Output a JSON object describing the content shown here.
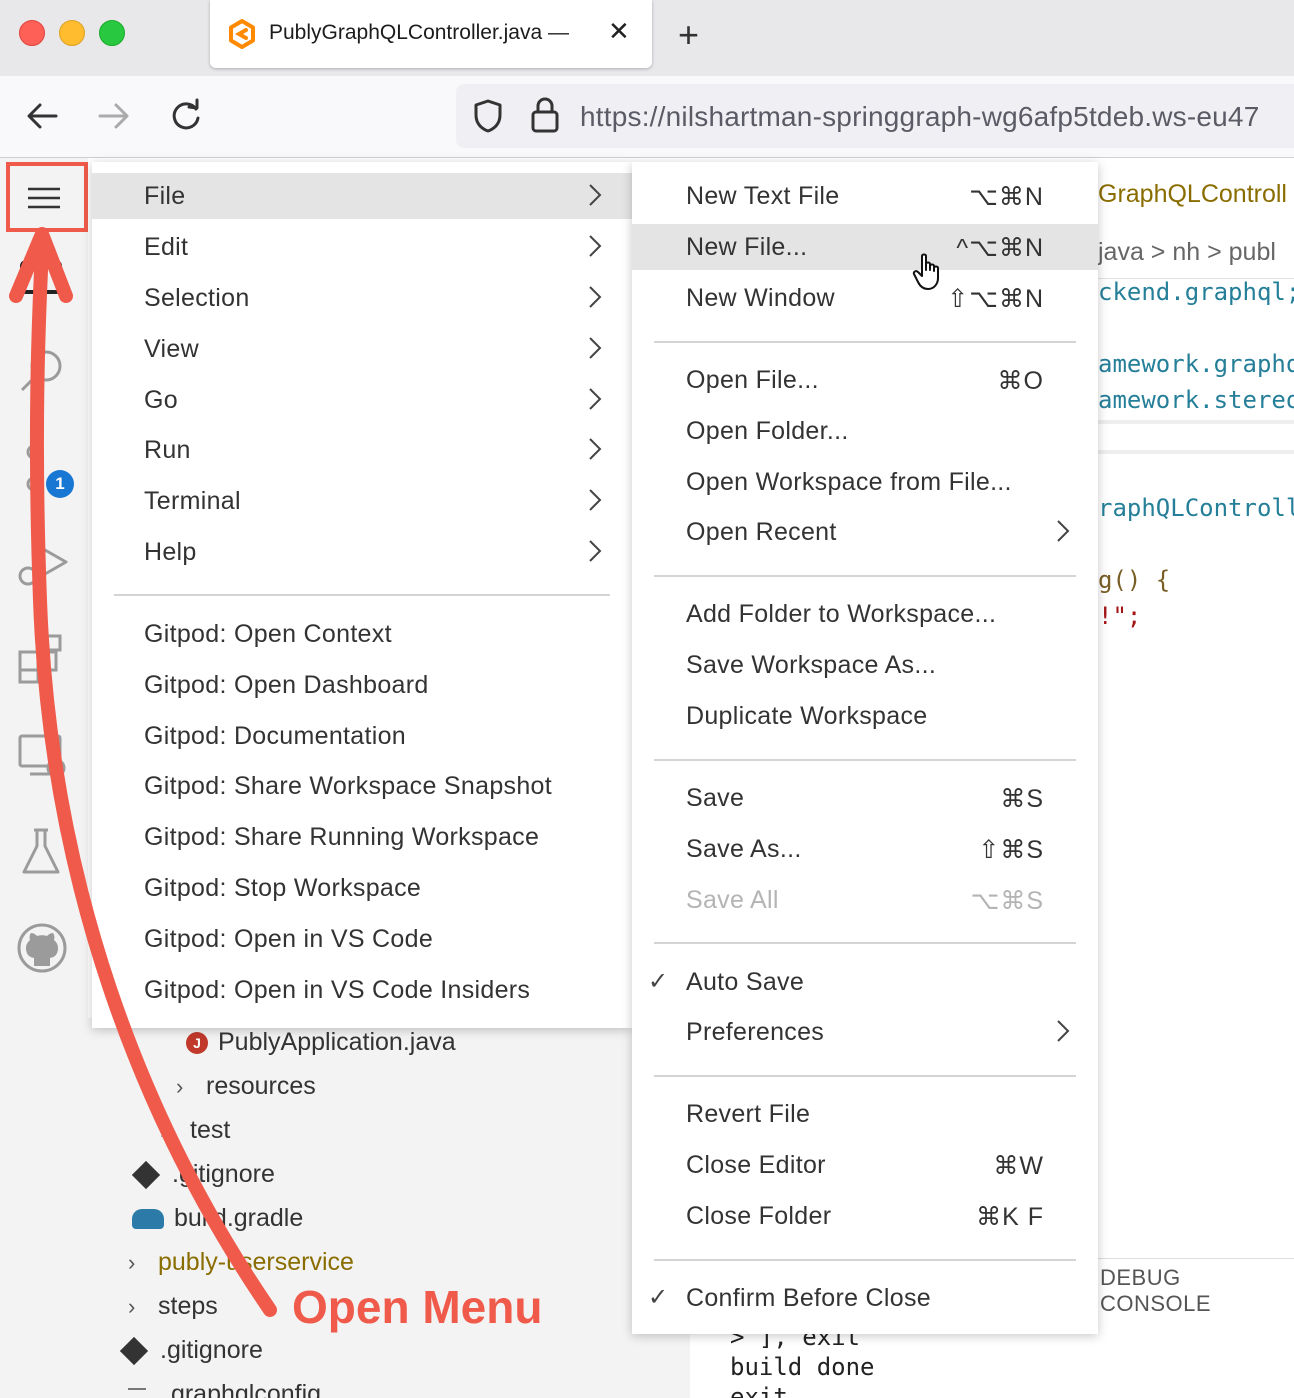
{
  "browser": {
    "tab_title": "PublyGraphQLController.java — ",
    "url": "https://nilshartman-springgraph-wg6afp5tdeb.ws-eu47"
  },
  "activity_bar": {
    "scm_badge": "1"
  },
  "explorer": {
    "rows": [
      {
        "label": "PublyApplication.java",
        "icon": "java-file-icon"
      },
      {
        "label": "resources",
        "icon": "chevron-right-icon"
      },
      {
        "label": "test",
        "icon": "chevron-right-icon"
      },
      {
        "label": ".gitignore",
        "icon": "git-file-icon"
      },
      {
        "label": "build.gradle",
        "icon": "gradle-icon"
      },
      {
        "label": "publy-userservice",
        "icon": "chevron-right-icon"
      },
      {
        "label": "steps",
        "icon": "chevron-right-icon"
      },
      {
        "label": ".gitignore",
        "icon": "git-file-icon"
      },
      {
        "label": ".graphqlconfig",
        "icon": "file-icon"
      }
    ]
  },
  "editor": {
    "lines": [
      "GraphQLControll",
      "java > nh > publ",
      "ckend.graphql;",
      "amework.graphq",
      "amework.stereo",
      "raphQLControll",
      "g() {",
      "!\";"
    ]
  },
  "panel": {
    "debug_console": "DEBUG CONSOLE",
    "terminal": [
      "> ], exit",
      "build done",
      "exit"
    ]
  },
  "main_menu": {
    "items": [
      {
        "label": "File",
        "submenu": true,
        "active": true
      },
      {
        "label": "Edit",
        "submenu": true
      },
      {
        "label": "Selection",
        "submenu": true
      },
      {
        "label": "View",
        "submenu": true
      },
      {
        "label": "Go",
        "submenu": true
      },
      {
        "label": "Run",
        "submenu": true
      },
      {
        "label": "Terminal",
        "submenu": true
      },
      {
        "label": "Help",
        "submenu": true
      },
      {
        "label": "Gitpod: Open Context"
      },
      {
        "label": "Gitpod: Open Dashboard"
      },
      {
        "label": "Gitpod: Documentation"
      },
      {
        "label": "Gitpod: Share Workspace Snapshot"
      },
      {
        "label": "Gitpod: Share Running Workspace"
      },
      {
        "label": "Gitpod: Stop Workspace"
      },
      {
        "label": "Gitpod: Open in VS Code"
      },
      {
        "label": "Gitpod: Open in VS Code Insiders"
      }
    ]
  },
  "file_menu": {
    "items": [
      {
        "label": "New Text File",
        "shortcut": "⌥⌘N"
      },
      {
        "label": "New File...",
        "shortcut": "^⌥⌘N",
        "active": true
      },
      {
        "label": "New Window",
        "shortcut": "⇧⌥⌘N"
      },
      {
        "label": "Open File...",
        "shortcut": "⌘O"
      },
      {
        "label": "Open Folder...",
        "shortcut": ""
      },
      {
        "label": "Open Workspace from File...",
        "shortcut": ""
      },
      {
        "label": "Open Recent",
        "shortcut": "",
        "submenu": true
      },
      {
        "label": "Add Folder to Workspace...",
        "shortcut": ""
      },
      {
        "label": "Save Workspace As...",
        "shortcut": ""
      },
      {
        "label": "Duplicate Workspace",
        "shortcut": ""
      },
      {
        "label": "Save",
        "shortcut": "⌘S"
      },
      {
        "label": "Save As...",
        "shortcut": "⇧⌘S"
      },
      {
        "label": "Save All",
        "shortcut": "⌥⌘S",
        "disabled": true
      },
      {
        "label": "Auto Save",
        "shortcut": "",
        "checked": true
      },
      {
        "label": "Preferences",
        "shortcut": "",
        "submenu": true
      },
      {
        "label": "Revert File",
        "shortcut": ""
      },
      {
        "label": "Close Editor",
        "shortcut": "⌘W"
      },
      {
        "label": "Close Folder",
        "shortcut": "⌘K F"
      },
      {
        "label": "Confirm Before Close",
        "shortcut": "",
        "checked": true
      }
    ]
  },
  "annotation": {
    "label": "Open Menu",
    "color": "#f05a4a"
  },
  "colors": {
    "accent_badge": "#1877d2",
    "annotation": "#f05a4a",
    "menu_highlight": "#e4e4e4"
  }
}
